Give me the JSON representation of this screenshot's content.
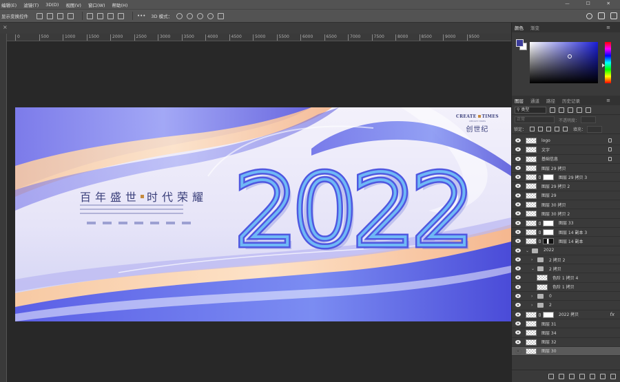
{
  "menubar": {
    "items": [
      "编辑(E)",
      "滤镜(T)",
      "3D(D)",
      "视图(V)",
      "窗口(W)",
      "帮助(H)"
    ],
    "window_controls": [
      "—",
      "☐",
      "✕"
    ]
  },
  "options": {
    "show_transform": "显示变换控件",
    "mode_label": "3D 模式："
  },
  "ruler": {
    "ticks": [
      "0",
      "500",
      "1000",
      "1500",
      "2000",
      "2500",
      "3000",
      "3500",
      "4000",
      "4500",
      "5000",
      "5500",
      "6000",
      "6500",
      "7000",
      "7500",
      "8000",
      "8500",
      "9000",
      "9500"
    ]
  },
  "artwork": {
    "year": "2022",
    "headline_left": "百年盛世",
    "headline_right": "时代荣耀",
    "brand_en_left": "CREATE",
    "brand_en_right": "TIMES",
    "brand_small": "CREATE TIMES",
    "brand_cn": "创世纪"
  },
  "color_panel": {
    "tabs": [
      "颜色",
      "渐变"
    ],
    "foreground": "#3b3c9a",
    "background": "#ffffff"
  },
  "layers_panel": {
    "tabs": [
      "图层",
      "通道",
      "路径",
      "历史记录"
    ],
    "filter_select": "类型",
    "blend_mode": "正常",
    "opacity_label": "不透明度：",
    "lock_label": "锁定：",
    "fill_label": "填充：",
    "layers": [
      {
        "name": "logo",
        "visible": true,
        "indent": 0,
        "type": "thumb",
        "locked": true
      },
      {
        "name": "文字",
        "visible": true,
        "indent": 0,
        "type": "thumb",
        "locked": true
      },
      {
        "name": "基础信息",
        "visible": true,
        "indent": 0,
        "type": "thumb",
        "locked": true
      },
      {
        "name": "图层 29 拷贝",
        "visible": true,
        "indent": 0,
        "type": "thumb"
      },
      {
        "name": "图层 29 拷贝 3",
        "visible": true,
        "indent": 0,
        "type": "thumb-mask"
      },
      {
        "name": "图层 29 拷贝 2",
        "visible": true,
        "indent": 0,
        "type": "thumb"
      },
      {
        "name": "图层 29",
        "visible": true,
        "indent": 0,
        "type": "thumb"
      },
      {
        "name": "图层 30 拷贝",
        "visible": true,
        "indent": 0,
        "type": "thumb"
      },
      {
        "name": "图层 30 拷贝 2",
        "visible": true,
        "indent": 0,
        "type": "thumb"
      },
      {
        "name": "图层 33",
        "visible": true,
        "indent": 0,
        "type": "thumb-mask"
      },
      {
        "name": "图层 14 副本 3",
        "visible": true,
        "indent": 0,
        "type": "thumb-mask"
      },
      {
        "name": "图层 14 副本",
        "visible": true,
        "indent": 0,
        "type": "thumb-mask-dark"
      },
      {
        "name": "2022",
        "visible": true,
        "indent": 0,
        "type": "folder-open"
      },
      {
        "name": "2 拷贝 2",
        "visible": true,
        "indent": 1,
        "type": "folder"
      },
      {
        "name": "2 拷贝",
        "visible": true,
        "indent": 1,
        "type": "folder-open"
      },
      {
        "name": "色阶 1 拷贝 4",
        "visible": true,
        "indent": 2,
        "type": "thumb"
      },
      {
        "name": "色阶 1 拷贝",
        "visible": true,
        "indent": 2,
        "type": "thumb"
      },
      {
        "name": "0",
        "visible": true,
        "indent": 1,
        "type": "folder"
      },
      {
        "name": "2",
        "visible": true,
        "indent": 1,
        "type": "folder"
      },
      {
        "name": "2022 拷贝",
        "visible": true,
        "indent": 0,
        "type": "thumb-mask",
        "fx": "fx"
      },
      {
        "name": "图层 31",
        "visible": true,
        "indent": 0,
        "type": "thumb"
      },
      {
        "name": "图层 34",
        "visible": true,
        "indent": 0,
        "type": "thumb"
      },
      {
        "name": "图层 32",
        "visible": true,
        "indent": 0,
        "type": "thumb"
      },
      {
        "name": "图层 30",
        "visible": false,
        "indent": 0,
        "type": "thumb",
        "selected": true
      }
    ],
    "bottom_icons": [
      "link-icon",
      "fx-icon",
      "mask-icon",
      "adjustment-icon",
      "folder-icon",
      "new-layer-icon",
      "trash-icon"
    ]
  }
}
